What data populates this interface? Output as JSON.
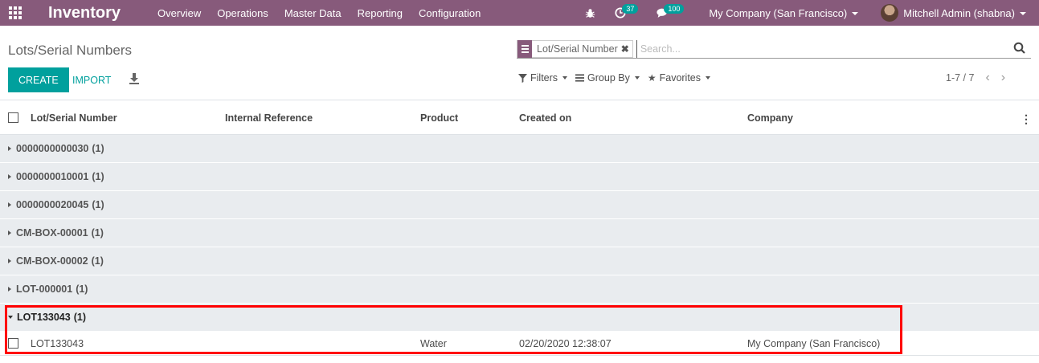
{
  "navbar": {
    "app_title": "Inventory",
    "menu": [
      "Overview",
      "Operations",
      "Master Data",
      "Reporting",
      "Configuration"
    ],
    "activity_count": "37",
    "messages_count": "100",
    "company": "My Company (San Francisco)",
    "user": "Mitchell Admin (shabna)"
  },
  "control": {
    "title": "Lots/Serial Numbers",
    "facet_label": "Lot/Serial Number",
    "search_placeholder": "Search...",
    "create_label": "CREATE",
    "import_label": "IMPORT",
    "filters_label": "Filters",
    "groupby_label": "Group By",
    "favorites_label": "Favorites",
    "pager": "1-7 / 7"
  },
  "table": {
    "columns": [
      "Lot/Serial Number",
      "Internal Reference",
      "Product",
      "Created on",
      "Company"
    ],
    "groups": [
      {
        "name": "0000000000030",
        "count": "(1)",
        "open": false
      },
      {
        "name": "0000000010001",
        "count": "(1)",
        "open": false
      },
      {
        "name": "0000000020045",
        "count": "(1)",
        "open": false
      },
      {
        "name": "CM-BOX-00001",
        "count": "(1)",
        "open": false
      },
      {
        "name": "CM-BOX-00002",
        "count": "(1)",
        "open": false
      },
      {
        "name": "LOT-000001",
        "count": "(1)",
        "open": false
      },
      {
        "name": "LOT133043",
        "count": "(1)",
        "open": true
      }
    ],
    "record": {
      "lot": "LOT133043",
      "internal_ref": "",
      "product": "Water",
      "created_on": "02/20/2020 12:38:07",
      "company": "My Company (San Francisco)"
    }
  },
  "colors": {
    "brand": "#875a7b",
    "accent": "#00a09d",
    "highlight": "#ff0000"
  }
}
